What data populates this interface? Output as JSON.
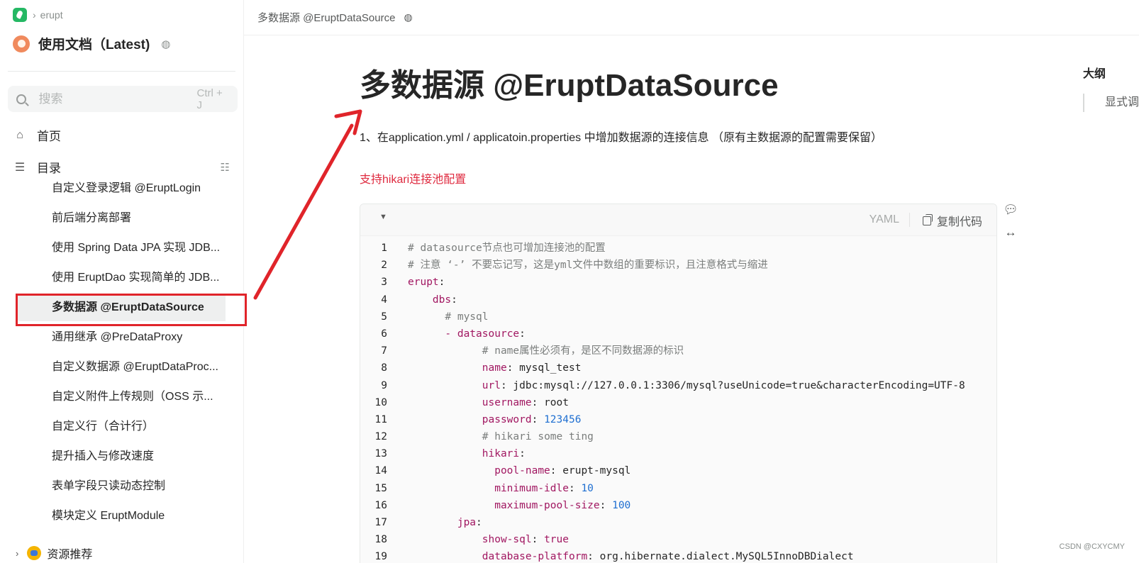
{
  "colors": {
    "annotation_red": "#e0242a",
    "note_red": "#df2a3f",
    "yaml_key": "#a11761",
    "yaml_number": "#1f6fd1",
    "yaml_comment": "#7a7d7c"
  },
  "sidebar": {
    "breadcrumb": {
      "icon": "app-logo-icon",
      "label": "erupt"
    },
    "book_title": "使用文档（Latest)",
    "search": {
      "placeholder": "搜索",
      "shortcut": "Ctrl + J"
    },
    "home_label": "首页",
    "toc_label": "目录",
    "toc_items": [
      "自定义登录逻辑 @EruptLogin",
      "前后端分离部署",
      "使用 Spring Data JPA 实现 JDB...",
      "使用 EruptDao 实现简单的 JDB...",
      "多数据源 @EruptDataSource",
      "通用继承 @PreDataProxy",
      "自定义数据源 @EruptDataProc...",
      "自定义附件上传规则（OSS 示...",
      "自定义行（合计行）",
      "提升插入与修改速度",
      "表单字段只读动态控制",
      "模块定义 EruptModule"
    ],
    "active_index": 4,
    "resources_label": "资源推荐"
  },
  "header": {
    "title": "多数据源 @EruptDataSource"
  },
  "content": {
    "title": "多数据源 @EruptDataSource",
    "para1": "1、在application.yml / applicatoin.properties 中增加数据源的连接信息 （原有主数据源的配置需要保留）",
    "note": "支持hikari连接池配置",
    "code": {
      "language": "YAML",
      "copy_label": "复制代码",
      "lines": [
        [
          [
            "c-comment",
            "# datasource节点也可增加连接池的配置"
          ]
        ],
        [
          [
            "c-comment",
            "# 注意 ‘-’ 不要忘记写，这是yml文件中数组的重要标识，且注意格式与缩进"
          ]
        ],
        [
          [
            "c-key",
            "erupt"
          ],
          [
            "c-plain",
            ":"
          ]
        ],
        [
          [
            "c-plain",
            "    "
          ],
          [
            "c-key",
            "dbs"
          ],
          [
            "c-plain",
            ":"
          ]
        ],
        [
          [
            "c-plain",
            "      "
          ],
          [
            "c-comment",
            "# mysql"
          ]
        ],
        [
          [
            "c-plain",
            "      "
          ],
          [
            "c-key",
            "- datasource"
          ],
          [
            "c-plain",
            ":"
          ]
        ],
        [
          [
            "c-plain",
            "            "
          ],
          [
            "c-comment",
            "# name属性必须有，是区不同数据源的标识"
          ]
        ],
        [
          [
            "c-plain",
            "            "
          ],
          [
            "c-key",
            "name"
          ],
          [
            "c-plain",
            ": mysql_test"
          ]
        ],
        [
          [
            "c-plain",
            "            "
          ],
          [
            "c-key",
            "url"
          ],
          [
            "c-plain",
            ": jdbc:mysql://127.0.0.1:3306/mysql?useUnicode=true&characterEncoding=UTF-8"
          ]
        ],
        [
          [
            "c-plain",
            "            "
          ],
          [
            "c-key",
            "username"
          ],
          [
            "c-plain",
            ": root"
          ]
        ],
        [
          [
            "c-plain",
            "            "
          ],
          [
            "c-key",
            "password"
          ],
          [
            "c-plain",
            ": "
          ],
          [
            "c-num",
            "123456"
          ]
        ],
        [
          [
            "c-plain",
            "            "
          ],
          [
            "c-comment",
            "# hikari some ting"
          ]
        ],
        [
          [
            "c-plain",
            "            "
          ],
          [
            "c-key",
            "hikari"
          ],
          [
            "c-plain",
            ":"
          ]
        ],
        [
          [
            "c-plain",
            "              "
          ],
          [
            "c-key",
            "pool-name"
          ],
          [
            "c-plain",
            ": erupt-mysql"
          ]
        ],
        [
          [
            "c-plain",
            "              "
          ],
          [
            "c-key",
            "minimum-idle"
          ],
          [
            "c-plain",
            ": "
          ],
          [
            "c-num",
            "10"
          ]
        ],
        [
          [
            "c-plain",
            "              "
          ],
          [
            "c-key",
            "maximum-pool-size"
          ],
          [
            "c-plain",
            ": "
          ],
          [
            "c-num",
            "100"
          ]
        ],
        [
          [
            "c-plain",
            "        "
          ],
          [
            "c-key",
            "jpa"
          ],
          [
            "c-plain",
            ":"
          ]
        ],
        [
          [
            "c-plain",
            "            "
          ],
          [
            "c-key",
            "show-sql"
          ],
          [
            "c-plain",
            ": "
          ],
          [
            "c-key",
            "true"
          ]
        ],
        [
          [
            "c-plain",
            "            "
          ],
          [
            "c-key",
            "database-platform"
          ],
          [
            "c-plain",
            ": org.hibernate.dialect.MySQL5InnoDBDialect"
          ]
        ]
      ]
    }
  },
  "outline": {
    "title": "大纲",
    "item": "显式调"
  },
  "watermark": "CSDN @CXYCMY"
}
